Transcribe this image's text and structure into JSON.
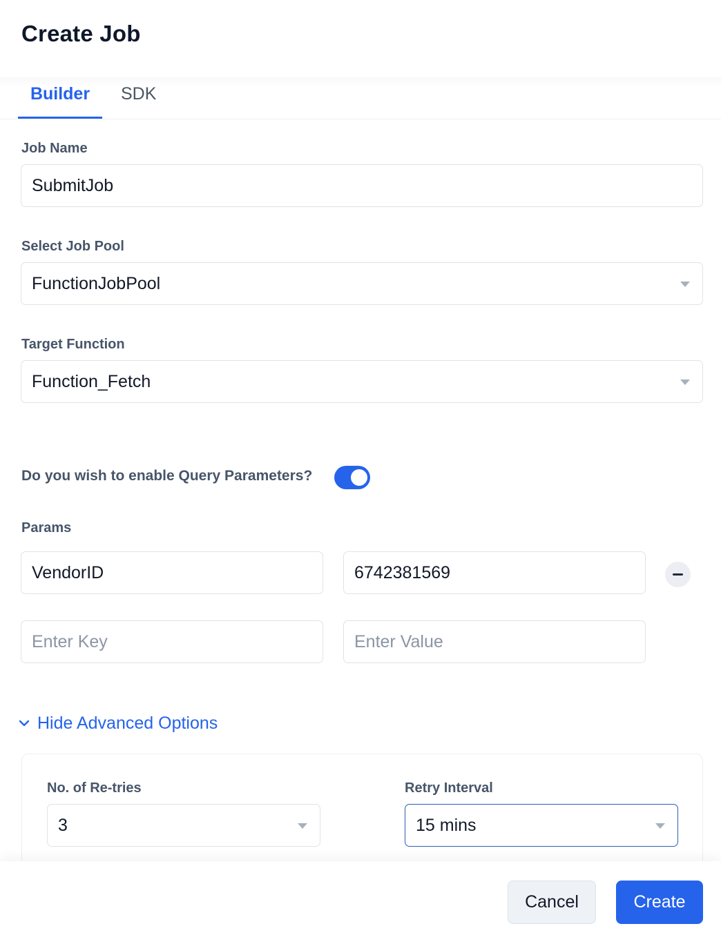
{
  "header": {
    "title": "Create Job"
  },
  "tabs": [
    {
      "label": "Builder",
      "active": true
    },
    {
      "label": "SDK",
      "active": false
    }
  ],
  "form": {
    "job_name": {
      "label": "Job Name",
      "value": "SubmitJob"
    },
    "job_pool": {
      "label": "Select Job Pool",
      "value": "FunctionJobPool"
    },
    "target_function": {
      "label": "Target Function",
      "value": "Function_Fetch"
    },
    "query_params_toggle": {
      "label": "Do you wish to enable Query Parameters?",
      "enabled": true
    },
    "params": {
      "label": "Params",
      "rows": [
        {
          "key": "VendorID",
          "value": "6742381569"
        }
      ],
      "new_row": {
        "key_placeholder": "Enter Key",
        "value_placeholder": "Enter Value"
      }
    }
  },
  "advanced": {
    "toggle_label": "Hide Advanced Options",
    "retries": {
      "label": "No. of Re-tries",
      "value": "3"
    },
    "retry_interval": {
      "label": "Retry Interval",
      "value": "15 mins"
    }
  },
  "footer": {
    "cancel_label": "Cancel",
    "create_label": "Create"
  },
  "colors": {
    "accent": "#2563eb",
    "label": "#475569",
    "border": "#dfe3e8"
  },
  "icons": [
    "chevron-down-icon",
    "caret-down-icon",
    "minus-icon"
  ]
}
